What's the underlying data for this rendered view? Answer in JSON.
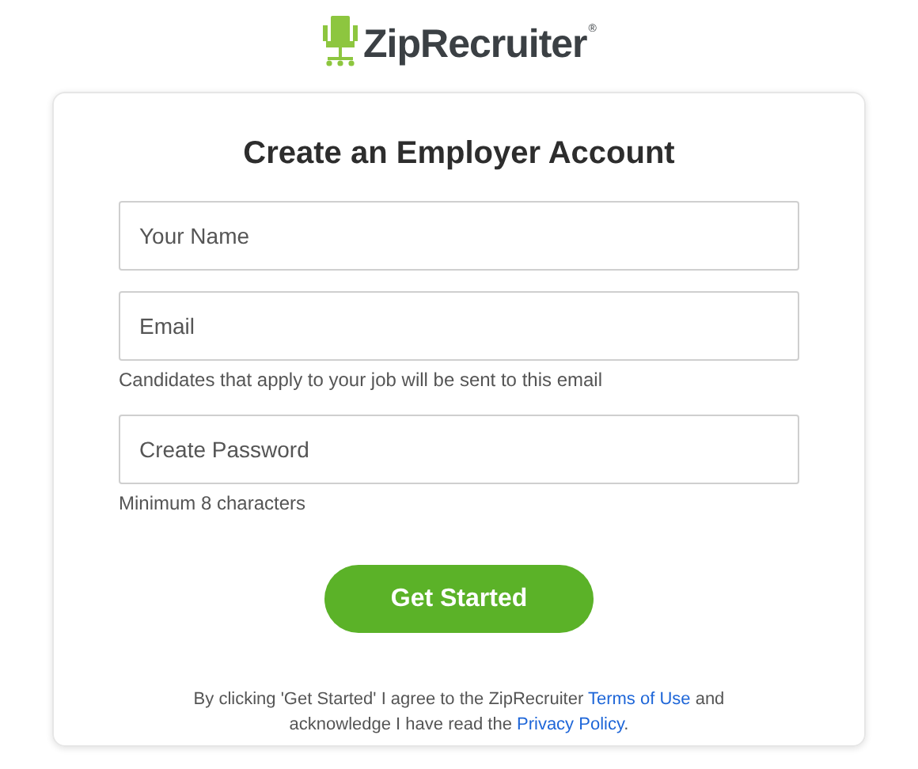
{
  "logo": {
    "text": "ZipRecruiter",
    "mark": "®"
  },
  "card": {
    "title": "Create an Employer Account",
    "fields": [
      {
        "placeholder": "Your Name"
      },
      {
        "placeholder": "Email",
        "hint": "Candidates that apply to your job will be sent to this email"
      },
      {
        "placeholder": "Create Password",
        "hint": "Minimum 8 characters"
      }
    ],
    "submit": "Get Started",
    "legal": {
      "before": "By clicking 'Get Started' I agree to the ZipRecruiter ",
      "terms_link": "Terms of Use",
      "middle": " and acknowledge I have read the ",
      "privacy_link": "Privacy Policy",
      "after": "."
    }
  }
}
